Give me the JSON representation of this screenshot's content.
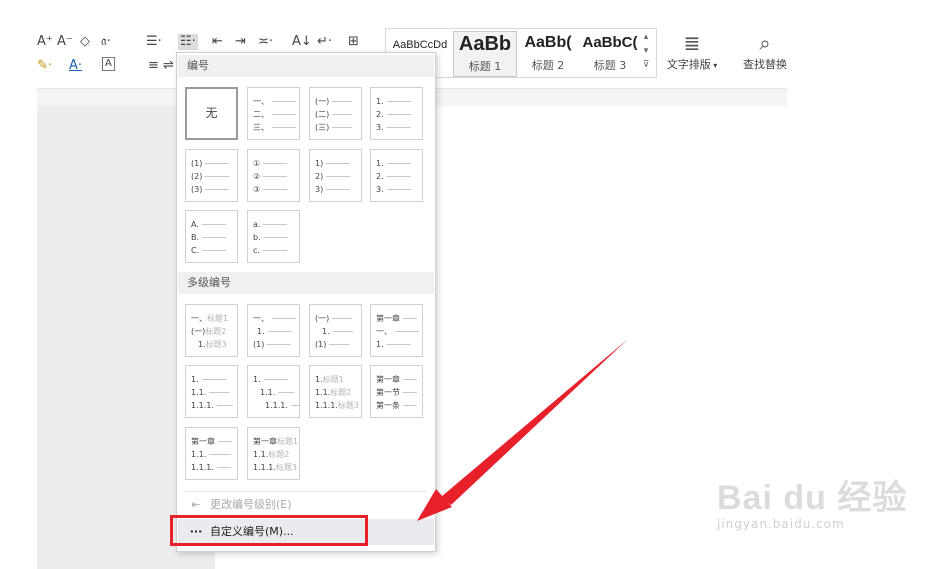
{
  "ribbon": {
    "row1_tools": [
      "A⁺",
      "A⁻",
      "◇",
      "𝔞·",
      "☰·",
      "☷·",
      "⇤",
      "⇥",
      "≍·",
      "A↓",
      "↵·",
      "⊞"
    ],
    "row2_tools": [
      "✎·",
      "A·",
      "A",
      "≡",
      "⇌"
    ],
    "styles": [
      {
        "sample": "AaBbCcDd",
        "name": ""
      },
      {
        "sample": "AaBb",
        "name": "标题 1"
      },
      {
        "sample": "AaBb(",
        "name": "标题 2"
      },
      {
        "sample": "AaBbC(",
        "name": "标题 3"
      }
    ],
    "text_layout_label": "文字排版",
    "find_replace_label": "查找替换"
  },
  "menu": {
    "numbering_header": "编号",
    "none_label": "无",
    "numbering_cells": [
      [
        "一、",
        "二、",
        "三、"
      ],
      [
        "(一)",
        "(二)",
        "(三)"
      ],
      [
        "1.",
        "2.",
        "3."
      ],
      [
        "(1)",
        "(2)",
        "(3)"
      ],
      [
        "①",
        "②",
        "③"
      ],
      [
        "1)",
        "2)",
        "3)"
      ],
      [
        "1.",
        "2.",
        "3."
      ],
      [
        "A.",
        "B.",
        "C."
      ],
      [
        "a.",
        "b.",
        "c."
      ]
    ],
    "multilevel_header": "多级编号",
    "multilevel_cells": [
      [
        {
          "n": "一、",
          "t": "标题1"
        },
        {
          "n": "(一)",
          "t": "标题2"
        },
        {
          "n": "1.",
          "t": "标题3"
        }
      ],
      [
        {
          "n": "一、",
          "t": ""
        },
        {
          "n": "1.",
          "t": ""
        },
        {
          "n": "(1)",
          "t": ""
        }
      ],
      [
        {
          "n": "(一)",
          "t": ""
        },
        {
          "n": "1.",
          "t": ""
        },
        {
          "n": "(1)",
          "t": ""
        }
      ],
      [
        {
          "n": "第一章",
          "t": ""
        },
        {
          "n": "一、",
          "t": ""
        },
        {
          "n": "1.",
          "t": ""
        }
      ],
      [
        {
          "n": "1.",
          "t": ""
        },
        {
          "n": "1.1.",
          "t": ""
        },
        {
          "n": "1.1.1.",
          "t": ""
        }
      ],
      [
        {
          "n": "1.",
          "t": ""
        },
        {
          "n": "1.1.",
          "t": ""
        },
        {
          "n": "1.1.1.",
          "t": ""
        }
      ],
      [
        {
          "n": "1.",
          "t": "标题1"
        },
        {
          "n": "1.1.",
          "t": "标题2"
        },
        {
          "n": "1.1.1.",
          "t": "标题3"
        }
      ],
      [
        {
          "n": "第一章",
          "t": ""
        },
        {
          "n": "第一节",
          "t": ""
        },
        {
          "n": "第一条",
          "t": ""
        }
      ],
      [
        {
          "n": "第一章",
          "t": ""
        },
        {
          "n": "1.1.",
          "t": ""
        },
        {
          "n": "1.1.1.",
          "t": ""
        }
      ],
      [
        {
          "n": "第一章",
          "t": "标题1"
        },
        {
          "n": "1.1.",
          "t": "标题2"
        },
        {
          "n": "1.1.1.",
          "t": "标题3"
        }
      ]
    ],
    "change_level_label": "更改编号级别(E)",
    "custom_numbering_label": "自定义编号(M)..."
  },
  "watermark": {
    "logo": "Bai du 经验",
    "url": "jingyan.baidu.com"
  },
  "colors": {
    "highlight_red": "#e8202a",
    "menu_hover": "#e9ebee"
  }
}
